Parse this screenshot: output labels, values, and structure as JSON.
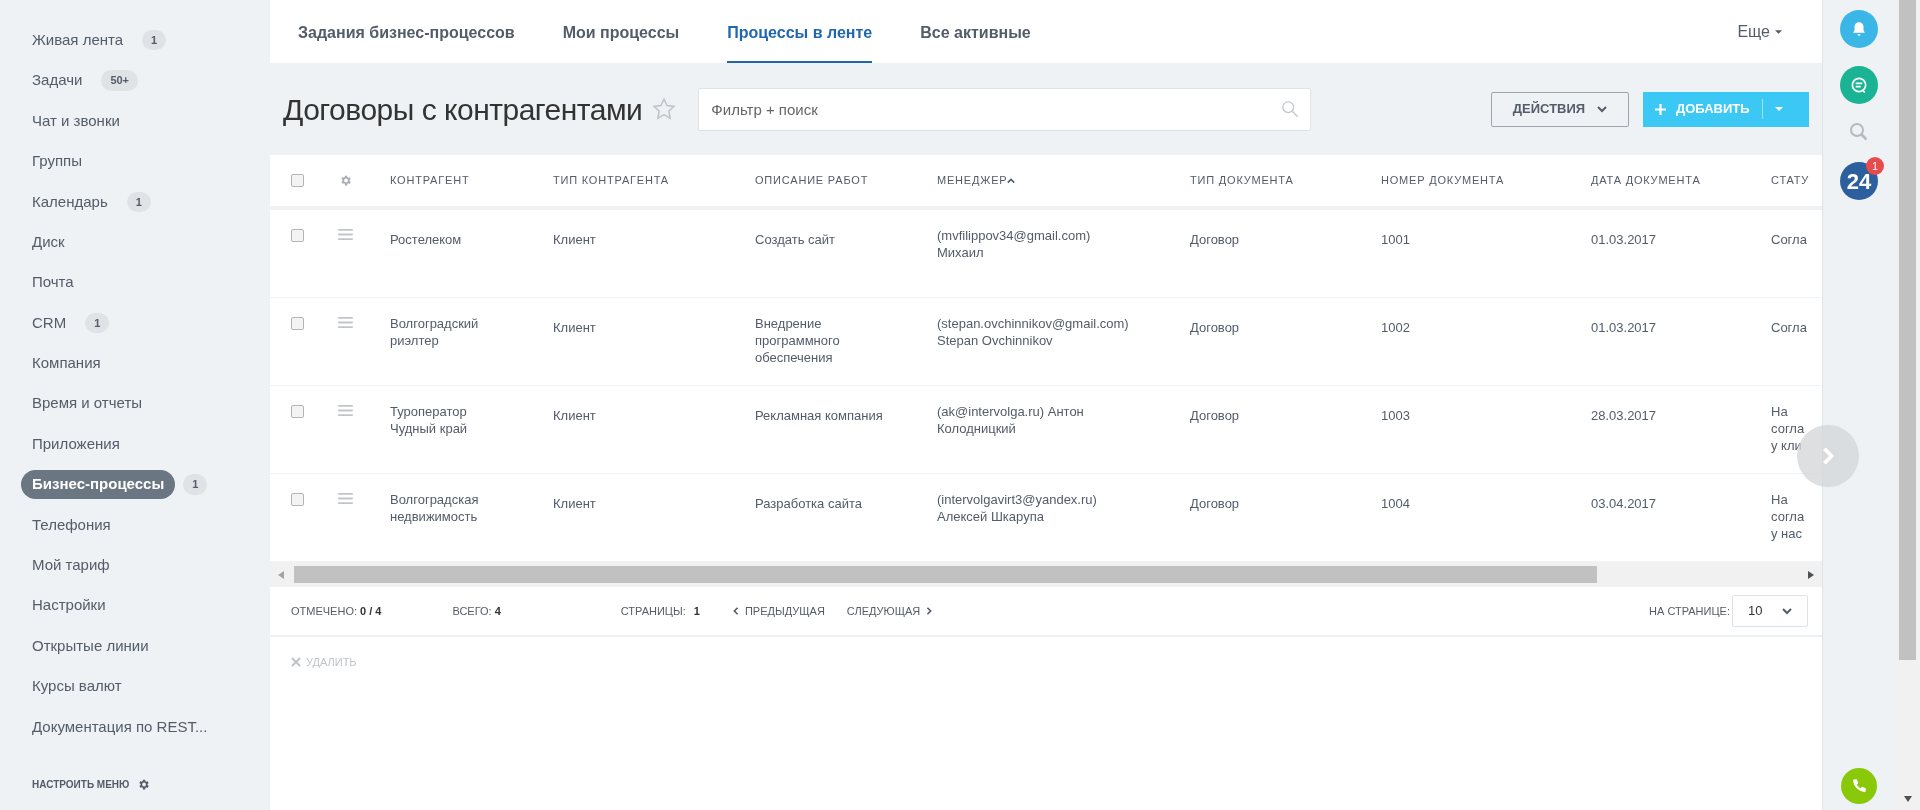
{
  "sidebar": {
    "items": [
      {
        "label": "Живая лента",
        "counter": "1",
        "selected": false
      },
      {
        "label": "Задачи",
        "counter": "50+",
        "selected": false
      },
      {
        "label": "Чат и звонки",
        "selected": false
      },
      {
        "label": "Группы",
        "selected": false
      },
      {
        "label": "Календарь",
        "counter": "1",
        "selected": false
      },
      {
        "label": "Диск",
        "selected": false
      },
      {
        "label": "Почта",
        "selected": false
      },
      {
        "label": "CRM",
        "counter": "1",
        "selected": false
      },
      {
        "label": "Компания",
        "selected": false
      },
      {
        "label": "Время и отчеты",
        "selected": false
      },
      {
        "label": "Приложения",
        "selected": false
      },
      {
        "label": "Бизнес-процессы",
        "counter": "1",
        "selected": true
      },
      {
        "label": "Телефония",
        "selected": false
      },
      {
        "label": "Мой тариф",
        "selected": false
      },
      {
        "label": "Настройки",
        "selected": false
      },
      {
        "label": "Открытые линии",
        "selected": false
      },
      {
        "label": "Курсы валют",
        "selected": false
      },
      {
        "label": "Документация по REST...",
        "selected": false
      }
    ],
    "footer": "НАСТРОИТЬ МЕНЮ"
  },
  "tabs": [
    {
      "label": "Задания бизнес-процессов",
      "selected": false
    },
    {
      "label": "Мои процессы",
      "selected": false
    },
    {
      "label": "Процессы в ленте",
      "selected": true
    },
    {
      "label": "Все активные",
      "selected": false
    }
  ],
  "more_tab": "Еще",
  "title": "Договоры с контрагентами",
  "favorite": false,
  "search": {
    "placeholder": "Фильтр + поиск"
  },
  "actions_button": "ДЕЙСТВИЯ",
  "add_button": "ДОБАВИТЬ",
  "table": {
    "select_all": {
      "checked": false
    },
    "columns": [
      {
        "label": "КОНТРАГЕНТ",
        "sorted": false
      },
      {
        "label": "ТИП КОНТРАГЕНТА",
        "sorted": false
      },
      {
        "label": "ОПИСАНИЕ РАБОТ",
        "sorted": false
      },
      {
        "label": "МЕНЕДЖЕР",
        "sorted": true
      },
      {
        "label": "ТИП ДОКУМЕНТА",
        "sorted": false
      },
      {
        "label": "НОМЕР ДОКУМЕНТА",
        "sorted": false
      },
      {
        "label": "ДАТА ДОКУМЕНТА",
        "sorted": false
      },
      {
        "label": "СТАТУ",
        "sorted": false
      }
    ],
    "rows": [
      {
        "checked": false,
        "cells": [
          "Ростелеком",
          "Клиент",
          "Создать сайт",
          "(mvfilippov34@gmail.com)\nМихаил",
          "Договор",
          "1001",
          "01.03.2017",
          "Согла"
        ]
      },
      {
        "checked": false,
        "cells": [
          "Волгоградский\nриэлтер",
          "Клиент",
          "Внедрение\nпрограммного\nобеспечения",
          "(stepan.ovchinnikov@gmail.com)\nStepan Ovchinnikov",
          "Договор",
          "1002",
          "01.03.2017",
          "Согла"
        ]
      },
      {
        "checked": false,
        "cells": [
          "Туроператор\nЧудный край",
          "Клиент",
          "Рекламная компания",
          "(ak@intervolga.ru) Антон\nКолодницкий",
          "Договор",
          "1003",
          "28.03.2017",
          "На\nсогла\nу кли"
        ]
      },
      {
        "checked": false,
        "cells": [
          "Волгоградская\nнедвижимость",
          "Клиент",
          "Разработка сайта",
          "(intervolgavirt3@yandex.ru)\nАлексей Шкарупа",
          "Договор",
          "1004",
          "03.04.2017",
          "На\nсогла\nу нас"
        ]
      }
    ]
  },
  "footer": {
    "marked_label": "ОТМЕЧЕНО:",
    "marked_value": "0 / 4",
    "total_label": "ВСЕГО:",
    "total_value": "4",
    "pages_label": "СТРАНИЦЫ:",
    "pages_value": "1",
    "prev": "ПРЕДЫДУЩАЯ",
    "next": "СЛЕДУЮЩАЯ",
    "per_page_label": "НА СТРАНИЦЕ:",
    "per_page_value": "10"
  },
  "delete_button": {
    "label": "УДАЛИТЬ",
    "disabled": true
  },
  "notifications": {
    "badge": "1"
  },
  "logo_text": "24"
}
